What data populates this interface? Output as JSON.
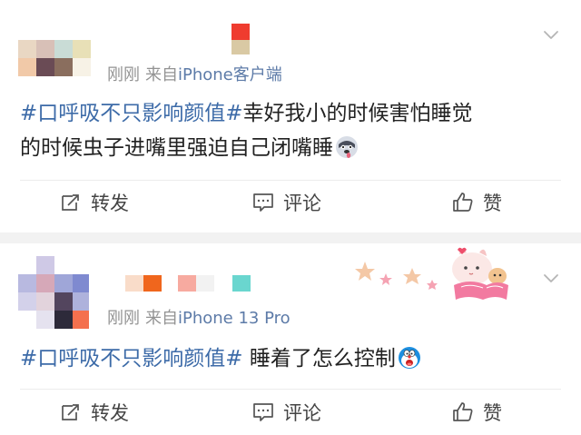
{
  "posts": [
    {
      "time": "刚刚",
      "source_prefix": "来自",
      "source": "iPhone客户端",
      "topic": "#口呼吸不只影响颜值#",
      "text_line1": "幸好我小的时候害怕睡觉",
      "text_line2": "的时候虫子进嘴里强迫自己闭嘴睡",
      "emoji": "husky-tongue-emoji"
    },
    {
      "time": "刚刚",
      "source_prefix": "来自",
      "source": "iPhone 13 Pro",
      "topic": "#口呼吸不只影响颜值#",
      "text": " 睡着了怎么控制",
      "emoji": "doraemon-shocked-emoji",
      "sticker": "stars-and-bunnies-sticker"
    }
  ],
  "actions": {
    "repost": "转发",
    "comment": "评论",
    "like": "赞"
  },
  "colors": {
    "topic_link": "#3d6ba8",
    "source_link": "#5d7ba8",
    "meta_gray": "#939393",
    "separator": "#f2f2f2"
  }
}
